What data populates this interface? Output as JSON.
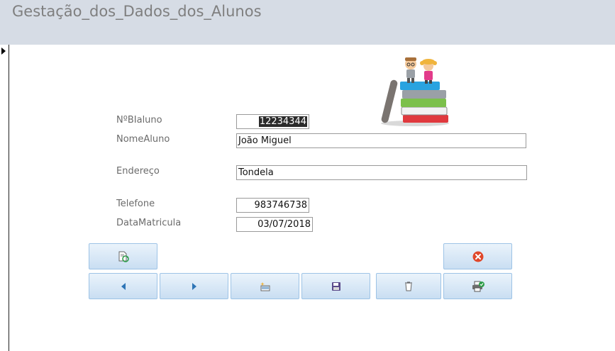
{
  "form": {
    "title": "Gestação_dos_Dados_dos_Alunos"
  },
  "fields": {
    "bi": {
      "label": "NºBIaluno",
      "value": "12234344"
    },
    "nome": {
      "label": "NomeAluno",
      "value": "João Miguel"
    },
    "endereco": {
      "label": "Endereço",
      "value": "Tondela"
    },
    "telefone": {
      "label": "Telefone",
      "value": "983746738"
    },
    "data": {
      "label": "DataMatricula",
      "value": "03/07/2018"
    }
  },
  "buttons": {
    "refresh": {
      "icon": "refresh-record-icon"
    },
    "close": {
      "icon": "close-icon",
      "color": "#e0482b"
    },
    "previous": {
      "icon": "previous-record-icon"
    },
    "next": {
      "icon": "next-record-icon"
    },
    "new": {
      "icon": "new-record-icon"
    },
    "save": {
      "icon": "save-record-icon"
    },
    "delete": {
      "icon": "delete-record-icon"
    },
    "print": {
      "icon": "print-icon"
    }
  },
  "colors": {
    "header": "#d6dce5",
    "button_border": "#9dc3e6",
    "arrow": "#2e75b6"
  }
}
